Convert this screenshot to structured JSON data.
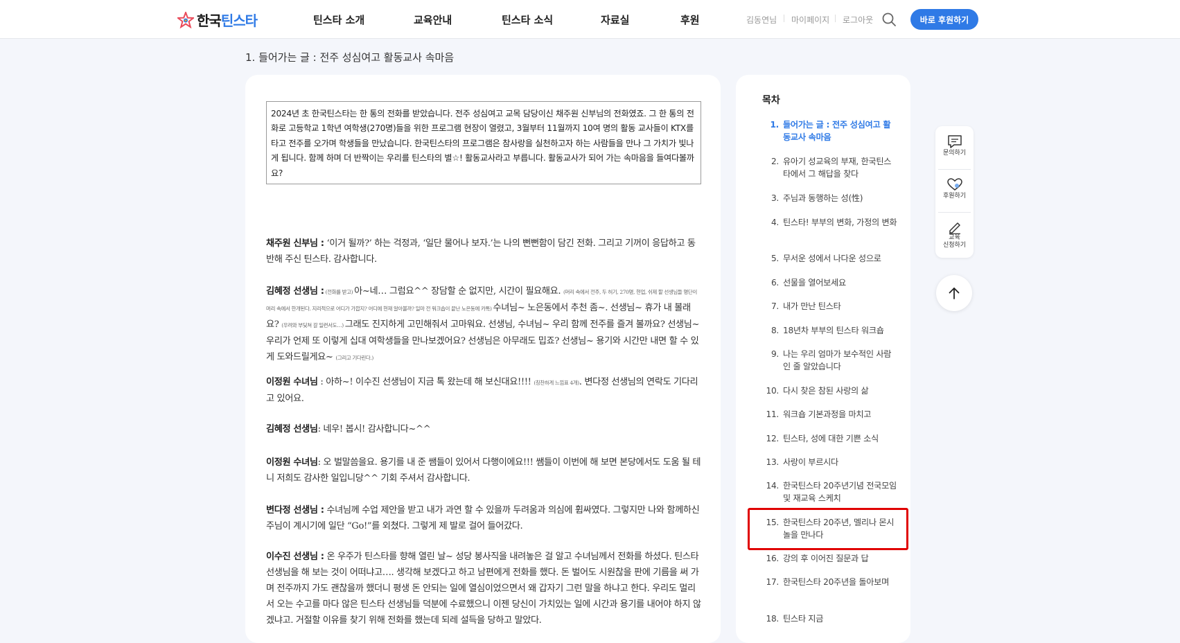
{
  "header": {
    "logo_text_a": "한국",
    "logo_text_b": "틴스타",
    "nav": [
      "틴스타 소개",
      "교육안내",
      "틴스타 소식",
      "자료실",
      "후원"
    ],
    "util": [
      "김동연님",
      "마이페이지",
      "로그아웃"
    ],
    "donate_label": "바로 후원하기"
  },
  "section_title": "1. 들어가는 글 : 전주 성심여고 활동교사 속마음",
  "intro": "2024년 초 한국틴스타는 한 통의 전화를 받았습니다. 전주 성심여고 교목 담당이신 채주원 신부님의 전화였죠. 그 한 통의 전화로 고등학교 1학년 여학생(270명)들을 위한 프로그램 현장이 열렸고, 3월부터 11월까지 10여 명의 활동 교사들이 KTX를 타고 전주를 오가며 학생들을 만났습니다. 한국틴스타의 프로그램은 참사랑을 실천하고자 하는 사람들을 만나 그 가치가 빛나게 됩니다. 함께 하며 더 반짝이는 우리를 틴스타의 별☆! 활동교사라고 부릅니다. 활동교사가 되어 가는 속마음을 들여다볼까요?",
  "dialog": {
    "d1_speaker": "채주원 신부님 :",
    "d1_text": " ‘이거 될까?’ 하는 걱정과, ‘일단 물어나 보자.’는 나의 뻔뻔함이 담긴 전화. 그리고 기꺼이 응답하고 동반해 주신 틴스타. 감사합니다.",
    "d2_speaker": "김혜정 선생님 :",
    "d2_small1": " (전화를 받고) ",
    "d2_text1": "아~네… 그럼요^^ 장담할 순 없지만, 시간이 필요해요. ",
    "d2_small2": "(머리 속에서 전주, 두 허기, 270명, 현업, 쉬제 할 선생님들 명단이 머리 속에서 한개된다. 지리적으로 어디가 가깝지? 어디에 현재 알아볼까? 일마 전 워크숍이 끝난 노은동에 카톡) ",
    "d2_text2": "수녀님~ 노은동에서 추천 좀~. 선생님~ 휴가 내 볼래요? ",
    "d2_small3": "(우려와 부딪쳐 갈 일련서도…) ",
    "d2_text3": "그래도 진지하게 고민해줘서 고마워요. 선생님, 수녀님~ 우리 함께 전주를 즐겨 볼까요? 선생님~ 우리가 언제 또 이렇게 십대 여학생들을 만나보겠어요? 선생님은 아무래도 밉죠? 선생님~ 용기와 시간만 내면 할 수 있게 도와드릴게요~ ",
    "d2_small4": "(그리고 기다린다.)",
    "d3_speaker": "이정원 수녀님",
    "d3_text1": " : 아하~! 이수진 선생님이 지금 톡 왔는데 해 보신대요!!!! ",
    "d3_small": "(칭찬하게 느낌표 4개)",
    "d3_text2": ". 변다정 선생님의 연락도 기다리고 있어요.",
    "d4_speaker": "김혜정 선생님",
    "d4_text": ": 네우! 봅시! 감사합니다~^^",
    "d5_speaker": "이정원 수녀님",
    "d5_text": ": 오 벌말씀을요. 용기를 내 준 쌤들이 있어서 다행이에요!!! 쌤들이 이번에 해 보면 본당에서도 도움 될 테니 저희도 감사한 일입니당^^ 기회 주셔서 감사합니다.",
    "d6_speaker": "변다정 선생님 :",
    "d6_text": " 수녀님께 수업 제안을 받고 내가 과연 할 수 있을까 두려움과 의심에 휩싸였다. 그렇지만 나와 함께하신 주님이 계시기에 일단 “Go!”를 외쳤다. 그렇게 제 발로 걸어 들어갔다.",
    "d7_speaker": "이수진 선생님 :",
    "d7_text": " 온 우주가 틴스타를 향해 열린 날~ 성당 봉사직을 내려놓은 걸 알고 수녀님께서 전화를 하셨다. 틴스타 선생님을 해 보는 것이 어떠냐고…. 생각해 보겠다고 하고 남편에게 전화를 했다. 돈 벌어도 시원찮을 판에 기름을 써 가며 전주까지 가도 괜찮을까 했더니 평생 돈 안되는 일에 열심이었으면서 왜 갑자기 그런 말을 하냐고 한다. 우리도 멀리서 오는 수고를 마다 않은 틴스타 선생님들 덕분에 수료했으니 이젠 당신이 가치있는 일에 시간과 용기를 내어야 하지 않겠냐고. 거절할 이유를 찾기 위해 전화를 했는데 되레 설득을 당하고 말았다."
  },
  "toc": {
    "title": "목차",
    "items": [
      {
        "num": "1.",
        "label": "들어가는 글 : 전주 성심여고 활동교사 속마음"
      },
      {
        "num": "2.",
        "label": "유아기 성교육의 부재, 한국틴스타에서 그 해답을 찾다"
      },
      {
        "num": "3.",
        "label": "주님과 동행하는 성(性)"
      },
      {
        "num": "4.",
        "label": "틴스타! 부부의 변화, 가정의 변화"
      },
      {
        "num": "5.",
        "label": "무서운 성에서 나다운 성으로"
      },
      {
        "num": "6.",
        "label": "선물을 열어보세요"
      },
      {
        "num": "7.",
        "label": "내가 만난 틴스타"
      },
      {
        "num": "8.",
        "label": "18년차 부부의 틴스타 워크숍"
      },
      {
        "num": "9.",
        "label": "나는 우리 엄마가 보수적인 사람인 줄 알았습니다"
      },
      {
        "num": "10.",
        "label": "다시 찾은 참된 사랑의 삶"
      },
      {
        "num": "11.",
        "label": "워크숍 기본과정을 마치고"
      },
      {
        "num": "12.",
        "label": "틴스타, 성에 대한 기쁜 소식"
      },
      {
        "num": "13.",
        "label": "사랑이 부르시다"
      },
      {
        "num": "14.",
        "label": "한국틴스타 20주년기념 전국모임 및 재교육 스케치"
      },
      {
        "num": "15.",
        "label": "한국틴스타 20주년, 멜리나 몬시놀을 만나다"
      },
      {
        "num": "16.",
        "label": "강의 후 이어진 질문과 답"
      },
      {
        "num": "17.",
        "label": "한국틴스타 20주년을 돌아보며"
      },
      {
        "num": "18.",
        "label": "틴스타 지금"
      }
    ]
  },
  "quick": {
    "inquiry": "문의하기",
    "donate": "후원하기",
    "edu_a": "교육",
    "edu_b": "신청하기"
  },
  "colors": {
    "accent": "#2f7ae6",
    "highlight": "#e00000"
  }
}
